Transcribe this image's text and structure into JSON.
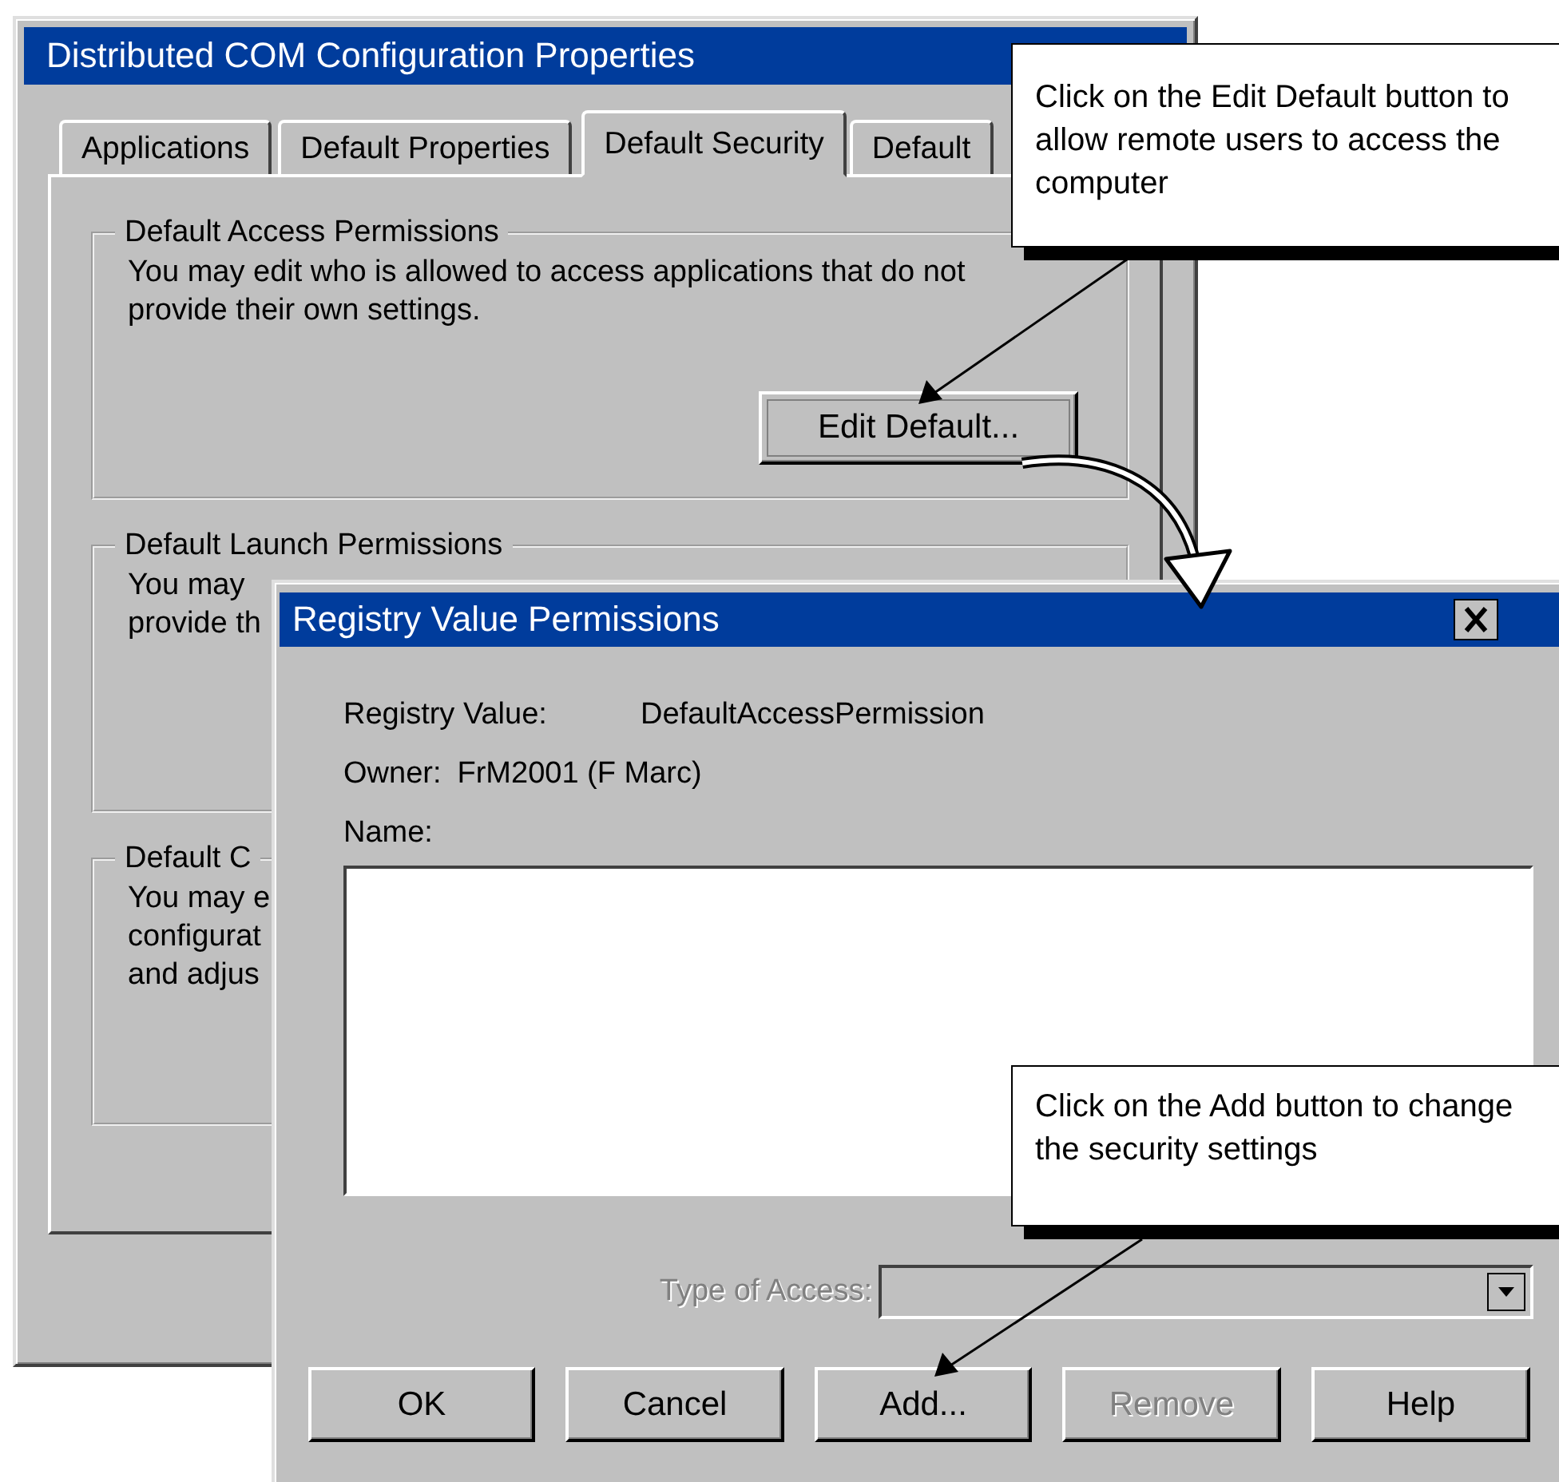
{
  "main_window": {
    "title": "Distributed COM Configuration Properties",
    "tabs": [
      {
        "label": "Applications",
        "selected": false
      },
      {
        "label": "Default Properties",
        "selected": false
      },
      {
        "label": "Default Security",
        "selected": true
      },
      {
        "label": "Default",
        "selected": false
      }
    ],
    "groups": [
      {
        "label": "Default Access Permissions",
        "lines": [
          "You may edit who is allowed to access applications that do not",
          "provide their own settings."
        ],
        "button": "Edit Default..."
      },
      {
        "label": "Default Launch Permissions",
        "lines": [
          "You may",
          "provide th"
        ]
      },
      {
        "label": "Default C",
        "lines": [
          "You may e",
          "configurat",
          "and adjus"
        ]
      }
    ]
  },
  "dialog": {
    "title": "Registry Value Permissions",
    "registry_value_label": "Registry Value:",
    "registry_value": "DefaultAccessPermission",
    "owner_label": "Owner:",
    "owner": "FrM2001 (F Marc)",
    "name_label": "Name:",
    "type_of_access": {
      "label": "Type of Access:",
      "disabled": true
    },
    "buttons": [
      {
        "label": "OK",
        "disabled": false
      },
      {
        "label": "Cancel",
        "disabled": false
      },
      {
        "label": "Add...",
        "disabled": false
      },
      {
        "label": "Remove",
        "disabled": true
      },
      {
        "label": "Help",
        "disabled": false
      }
    ]
  },
  "callouts": [
    {
      "text": "Click on the Edit Default button to allow remote users to access the computer"
    },
    {
      "text": "Click on the Add button to change the security settings"
    }
  ]
}
